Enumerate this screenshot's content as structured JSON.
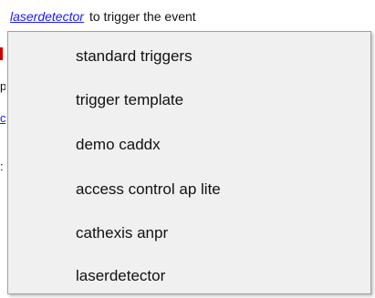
{
  "header": {
    "link_text": "laserdetector",
    "rest_text": "to trigger the event"
  },
  "menu": {
    "items": [
      {
        "label": "standard triggers"
      },
      {
        "label": "trigger template"
      },
      {
        "label": "demo caddx"
      },
      {
        "label": "access control ap lite"
      },
      {
        "label": "cathexis anpr"
      },
      {
        "label": "laserdetector"
      }
    ]
  },
  "colors": {
    "link": "#1a1aee",
    "menu_background": "#f0f0f0",
    "menu_border": "#a0a0a0"
  }
}
